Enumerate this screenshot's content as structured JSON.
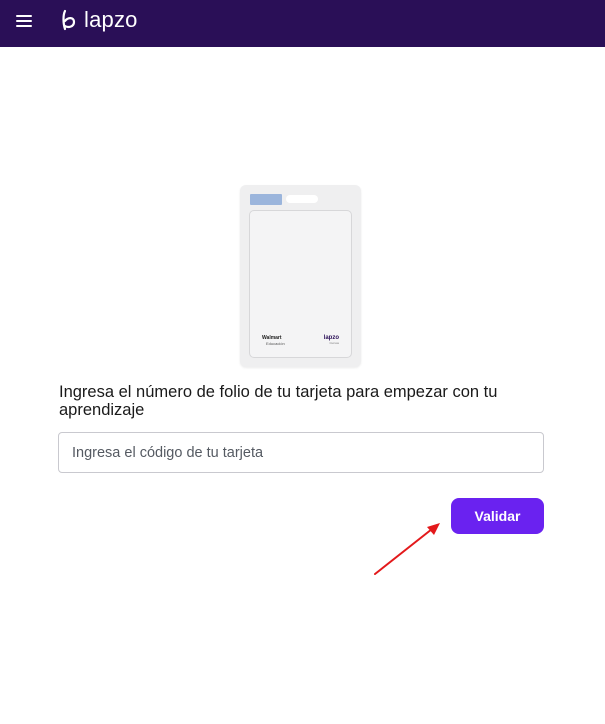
{
  "header": {
    "brand_name": "lapzo",
    "background_color": "#2a0f57",
    "menu_icon": "hamburger-menu-icon"
  },
  "card_image": {
    "left_logo": "Walmart",
    "left_logo_sub": "Educación",
    "right_logo": "lapzo",
    "right_logo_sub": "Cursos"
  },
  "main": {
    "prompt": "Ingresa el número de folio de tu tarjeta para empezar con tu aprendizaje",
    "code_input": {
      "placeholder": "Ingresa el código de tu tarjeta",
      "value": ""
    },
    "validate_label": "Validar",
    "accent_color": "#6a22f0"
  },
  "annotation": {
    "arrow_color": "#e3191b",
    "arrow_icon": "red-arrow-icon"
  }
}
